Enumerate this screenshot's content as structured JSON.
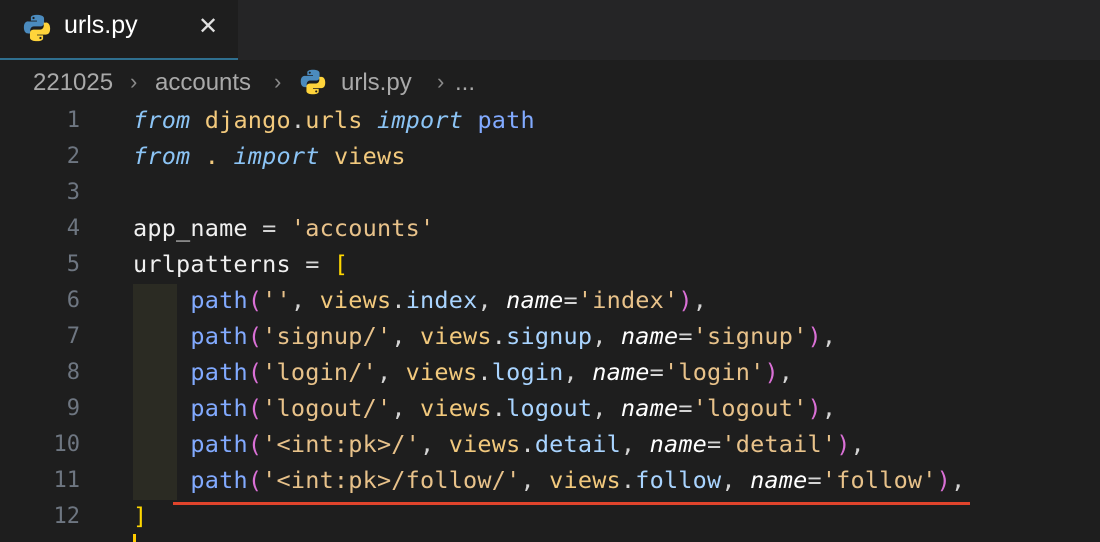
{
  "tab": {
    "filename": "urls.py",
    "close_glyph": "✕",
    "icon": "python-icon"
  },
  "breadcrumb": {
    "items": [
      "221025",
      "accounts",
      "urls.py",
      "..."
    ],
    "separator": "›"
  },
  "editor": {
    "line_numbers": [
      "1",
      "2",
      "3",
      "4",
      "5",
      "6",
      "7",
      "8",
      "9",
      "10",
      "11",
      "12"
    ],
    "lines": [
      "from django.urls import path",
      "from . import views",
      "",
      "app_name = 'accounts'",
      "urlpatterns = [",
      "    path('', views.index, name='index'),",
      "    path('signup/', views.signup, name='signup'),",
      "    path('login/', views.login, name='login'),",
      "    path('logout/', views.logout, name='logout'),",
      "    path('<int:pk>/', views.detail, name='detail'),",
      "    path('<int:pk>/follow/', views.follow, name='follow'),",
      "]"
    ],
    "error_squiggle_line": 11
  },
  "colors": {
    "background": "#1e1e1e",
    "squiggle": "#e0442c",
    "tab_underline": "#2f6f8f"
  }
}
